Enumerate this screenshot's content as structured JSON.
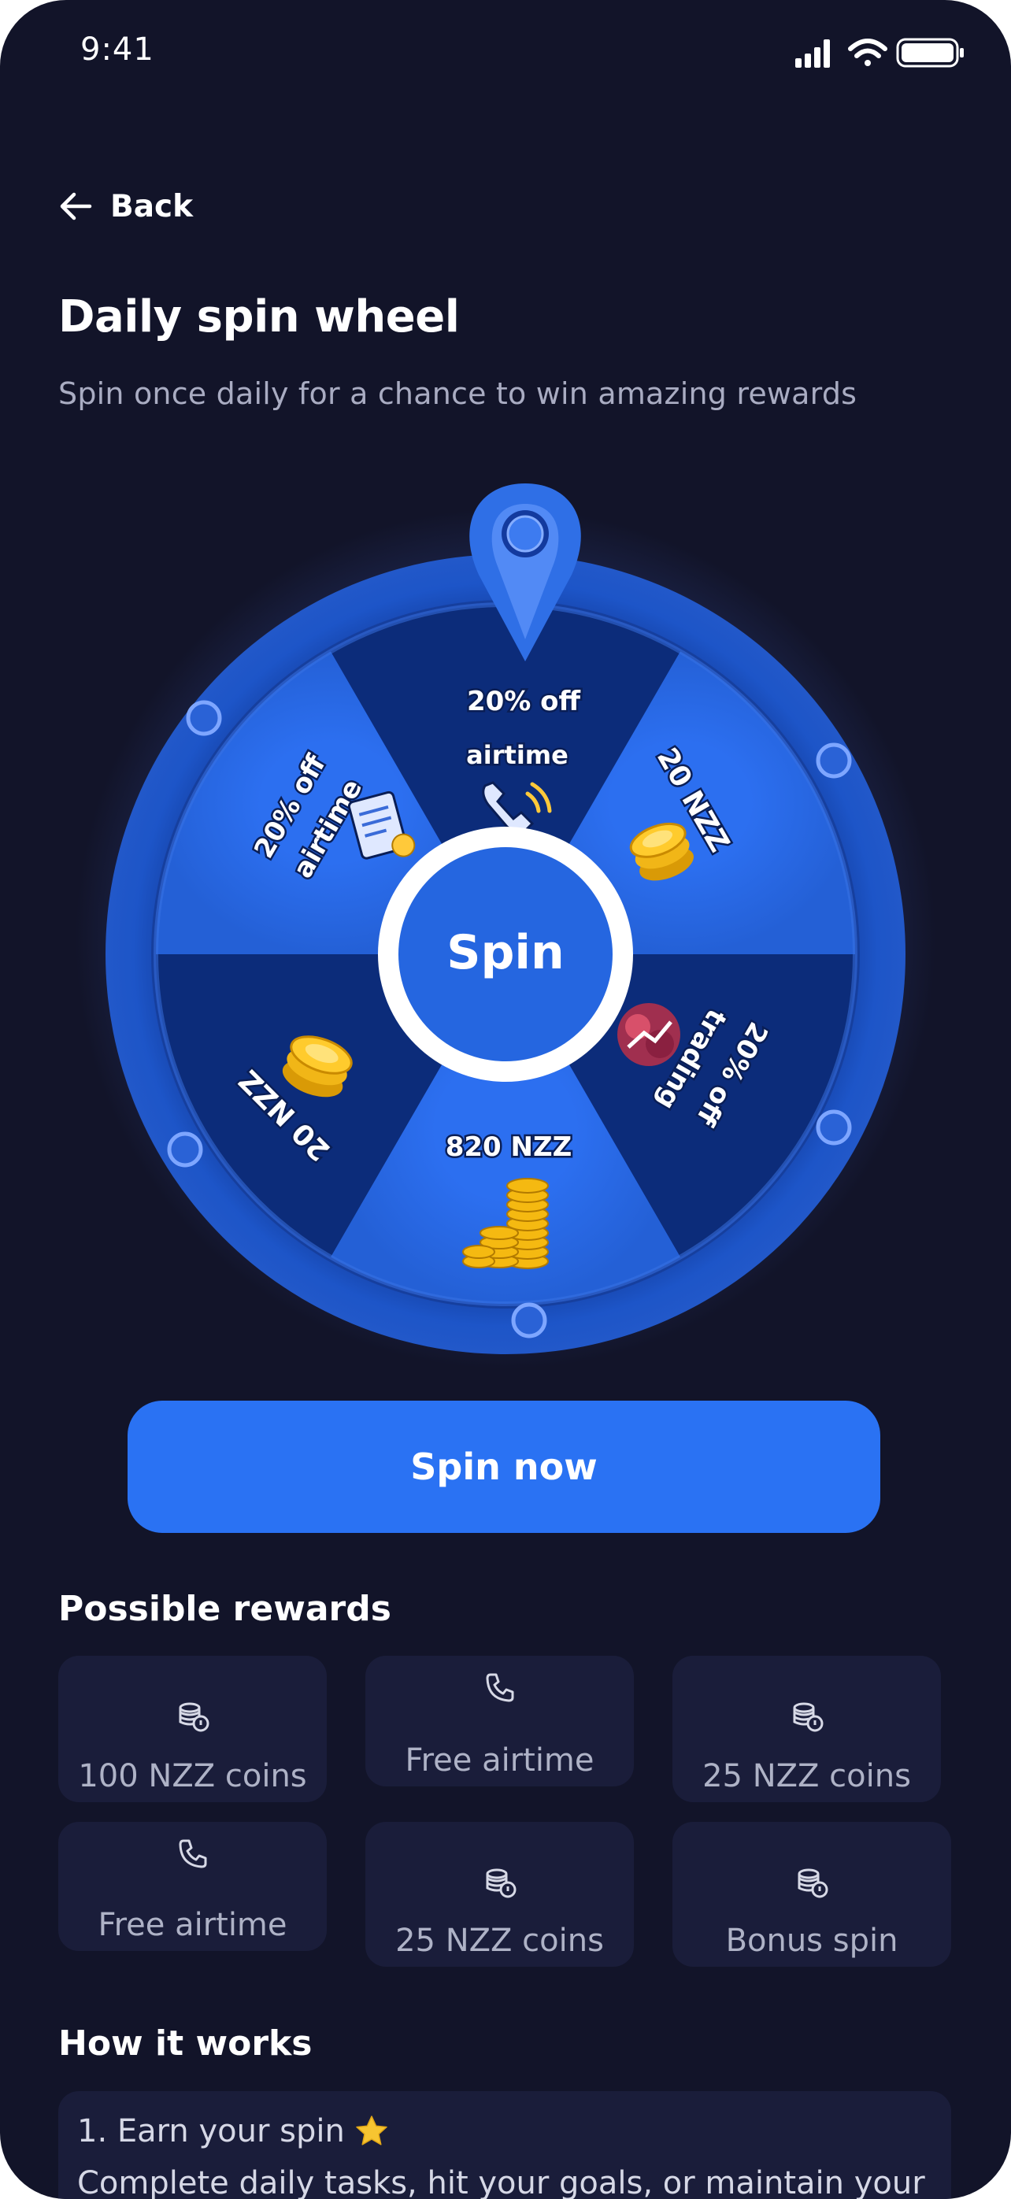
{
  "status": {
    "time": "9:41"
  },
  "header": {
    "back_label": "Back",
    "title": "Daily spin wheel",
    "subtitle": "Spin once daily for a chance to win amazing rewards"
  },
  "wheel": {
    "center_label": "Spin",
    "segments": [
      {
        "line1": "20% off",
        "line2": "airtime",
        "icon": "phone-icon"
      },
      {
        "line1": "20 NZZ",
        "icon": "coin-stack-icon"
      },
      {
        "line1": "20% off",
        "line2": "trading",
        "icon": "trading-icon"
      },
      {
        "line1": "820 NZZ",
        "icon": "gold-coins-icon"
      },
      {
        "line1": "20 NZZ",
        "icon": "coin-stack-icon"
      },
      {
        "line1": "20% off",
        "line2": "airtime",
        "icon": "receipt-icon"
      }
    ],
    "colors": {
      "light": "#2a6ee8",
      "dark": "#0c2c7a",
      "rim": "#1d54c9",
      "pointer": "#2f6fe6"
    }
  },
  "spin_button": {
    "label": "Spin now"
  },
  "rewards": {
    "title": "Possible rewards",
    "items": [
      {
        "label": "100 NZZ coins",
        "icon": "coins-icon"
      },
      {
        "label": "Free airtime",
        "icon": "phone-icon"
      },
      {
        "label": "25 NZZ coins",
        "icon": "coins-icon"
      },
      {
        "label": "Free airtime",
        "icon": "phone-icon"
      },
      {
        "label": "25 NZZ coins",
        "icon": "coins-icon"
      },
      {
        "label": "Bonus spin",
        "icon": "coins-icon"
      }
    ]
  },
  "how": {
    "title": "How it works",
    "step1_title": "1. Earn your spin",
    "step1_body": "Complete daily tasks, hit your goals, or maintain your"
  },
  "colors": {
    "background": "#121429",
    "card": "#1a1d3a",
    "accent": "#2a72f3",
    "muted_text": "#a9acc2"
  }
}
